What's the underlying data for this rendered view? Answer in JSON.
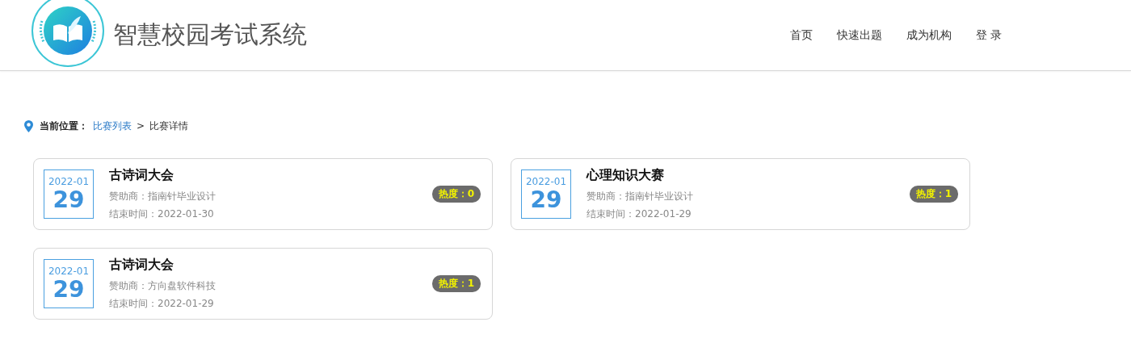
{
  "header": {
    "title": "智慧校园考试系统",
    "nav": [
      {
        "label": "首页"
      },
      {
        "label": "快速出题"
      },
      {
        "label": "成为机构"
      },
      {
        "label": "登 录"
      }
    ]
  },
  "breadcrumb": {
    "label": "当前位置：",
    "items": [
      {
        "label": "比赛列表",
        "kind": "link"
      },
      {
        "label": ">",
        "kind": "separator"
      },
      {
        "label": "比赛详情",
        "kind": "current"
      }
    ]
  },
  "contests": [
    {
      "month": "2022-01",
      "day": "29",
      "title": "古诗词大会",
      "sponsor": "赞助商：指南针毕业设计",
      "end_time": "结束时间：2022-01-30",
      "heat": "热度：0"
    },
    {
      "month": "2022-01",
      "day": "29",
      "title": "心理知识大赛",
      "sponsor": "赞助商：指南针毕业设计",
      "end_time": "结束时间：2022-01-29",
      "heat": "热度：1"
    },
    {
      "month": "2022-01",
      "day": "29",
      "title": "古诗词大会",
      "sponsor": "赞助商：方向盘软件科技",
      "end_time": "结束时间：2022-01-29",
      "heat": "热度：1"
    }
  ]
}
